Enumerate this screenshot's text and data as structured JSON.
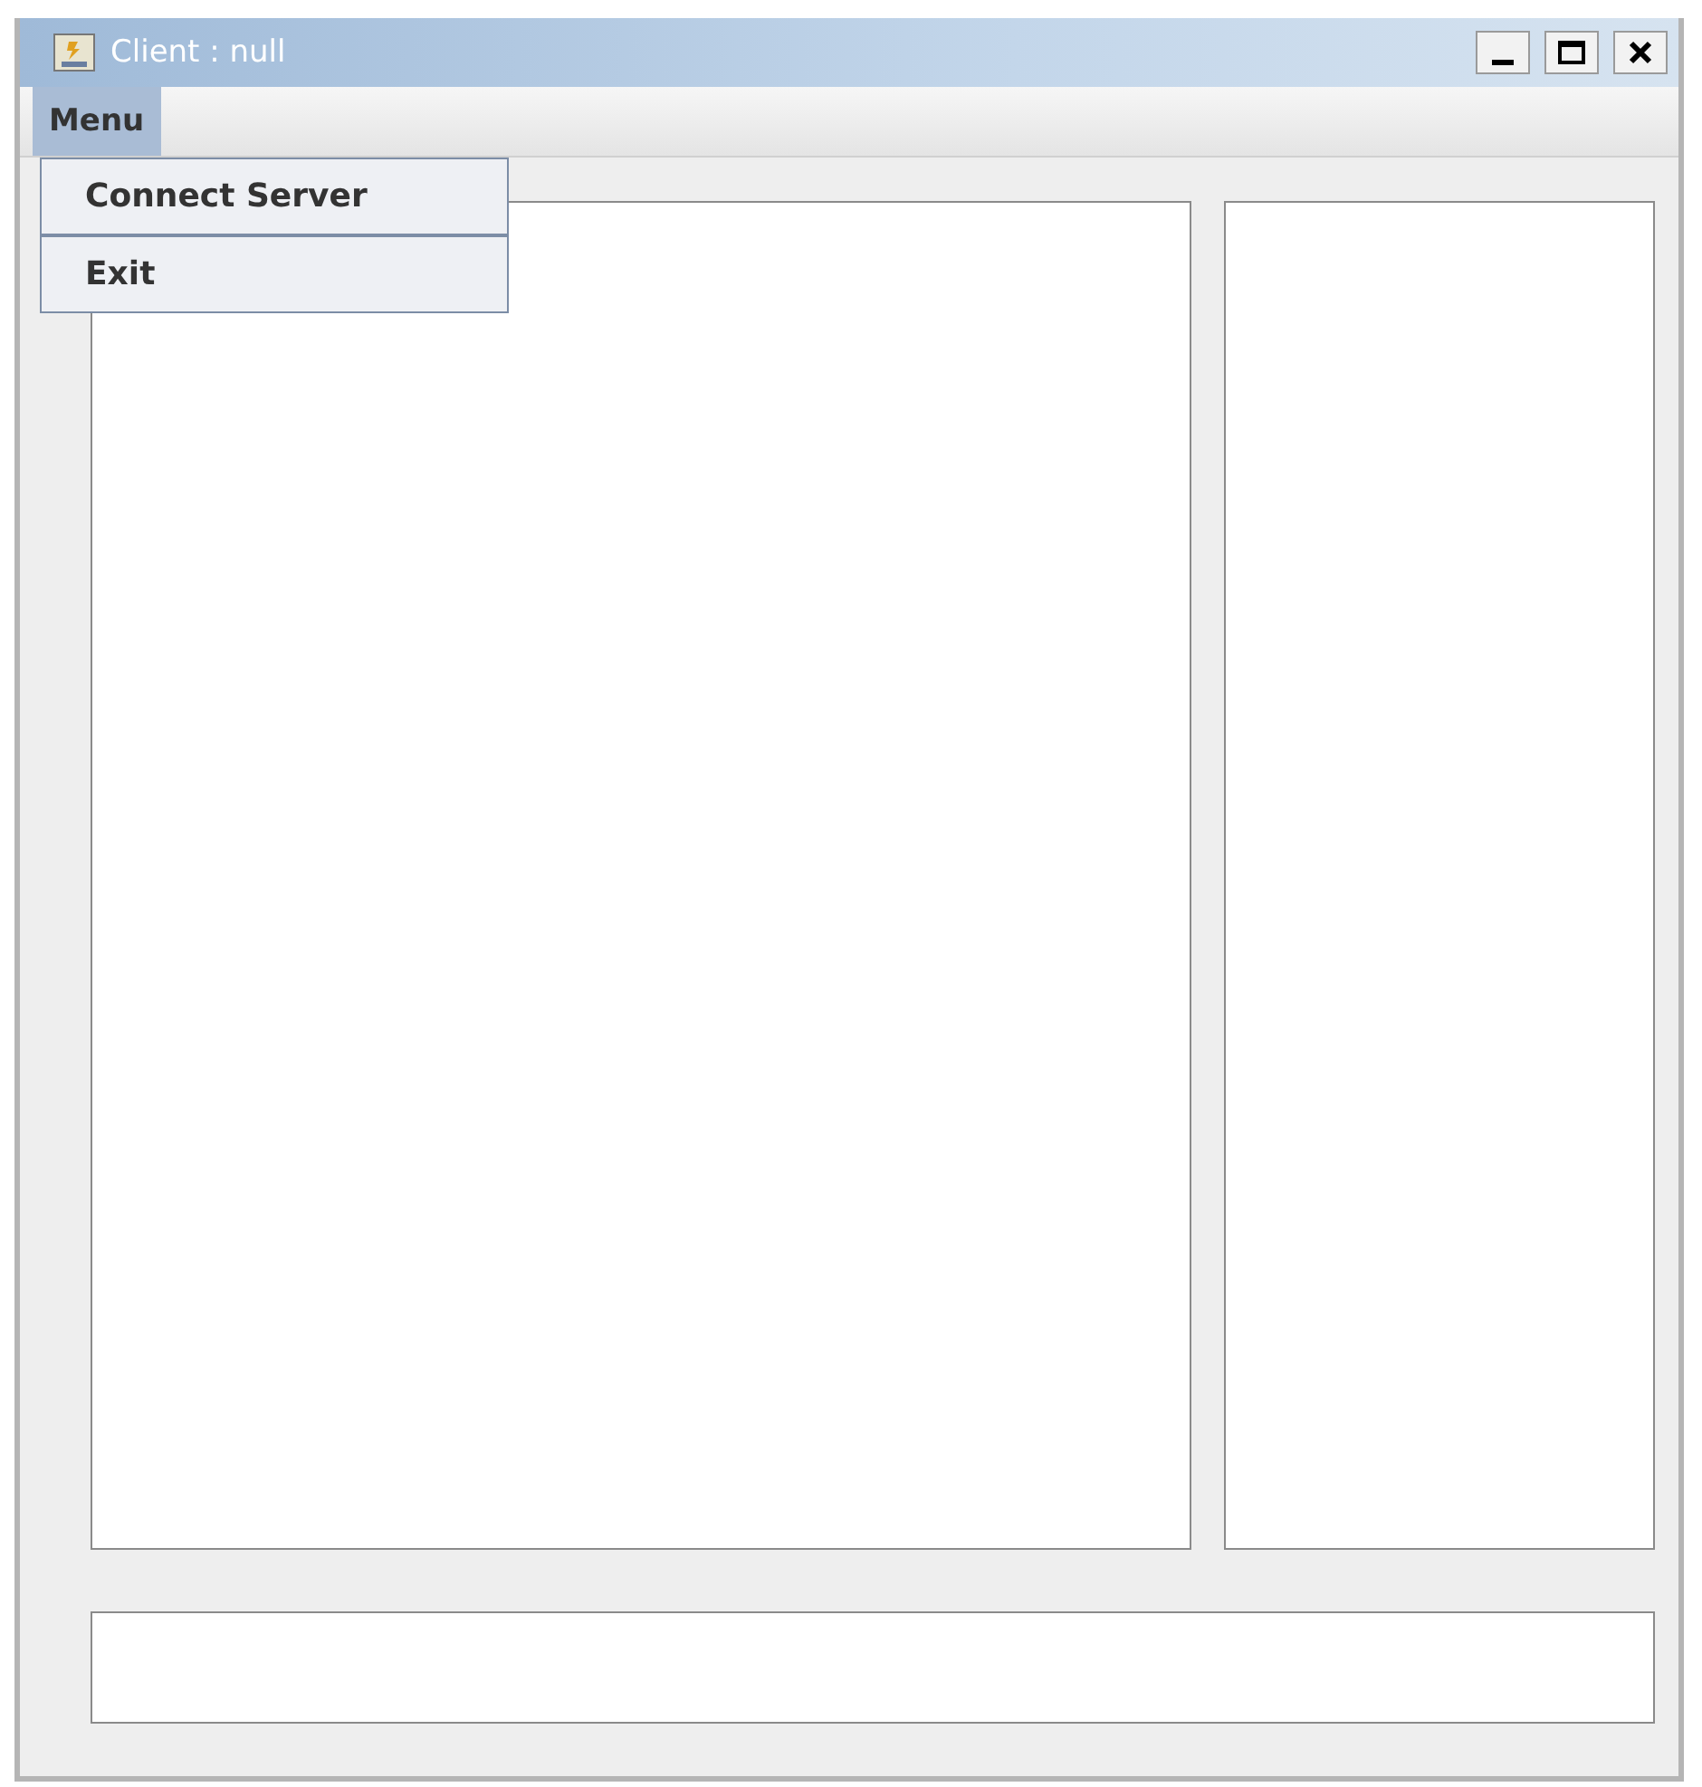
{
  "window": {
    "title": "Client : null"
  },
  "menubar": [
    {
      "label": "Menu",
      "selected": true,
      "expanded": true,
      "items": [
        {
          "label": "Connect Server"
        },
        {
          "label": "Exit"
        }
      ]
    }
  ]
}
